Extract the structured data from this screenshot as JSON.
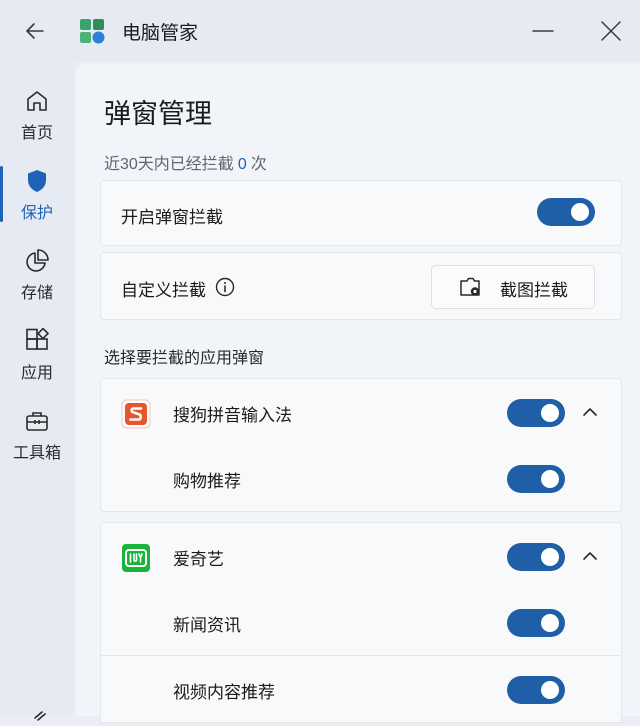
{
  "window": {
    "title": "电脑管家",
    "back_icon": "arrow-left-icon",
    "minimize_icon": "minimize-icon",
    "close_icon": "close-icon"
  },
  "sidebar": {
    "items": [
      {
        "label": "首页",
        "icon": "home-icon",
        "active": false
      },
      {
        "label": "保护",
        "icon": "shield-icon",
        "active": true
      },
      {
        "label": "存储",
        "icon": "pie-chart-icon",
        "active": false
      },
      {
        "label": "应用",
        "icon": "apps-icon",
        "active": false
      },
      {
        "label": "工具箱",
        "icon": "toolbox-icon",
        "active": false
      }
    ]
  },
  "page": {
    "title": "弹窗管理",
    "stats_prefix": "近30天内已经拦截",
    "stats_count": "0",
    "stats_suffix": "次"
  },
  "settings": {
    "enable_label": "开启弹窗拦截",
    "enable_on": true,
    "custom_label": "自定义拦截",
    "screenshot_button": "截图拦截"
  },
  "apps_section_label": "选择要拦截的应用弹窗",
  "apps": [
    {
      "name": "搜狗拼音输入法",
      "icon": "sogou-icon",
      "enabled": true,
      "expanded": true,
      "popups": [
        {
          "label": "购物推荐",
          "enabled": true
        }
      ]
    },
    {
      "name": "爱奇艺",
      "icon": "iqiyi-icon",
      "enabled": true,
      "expanded": true,
      "popups": [
        {
          "label": "新闻资讯",
          "enabled": true
        },
        {
          "label": "视频内容推荐",
          "enabled": true
        }
      ]
    }
  ],
  "colors": {
    "accent": "#1f63b6",
    "toggle_on": "#1f5fa8",
    "sogou": "#e8542b",
    "iqiyi": "#19b43a"
  }
}
